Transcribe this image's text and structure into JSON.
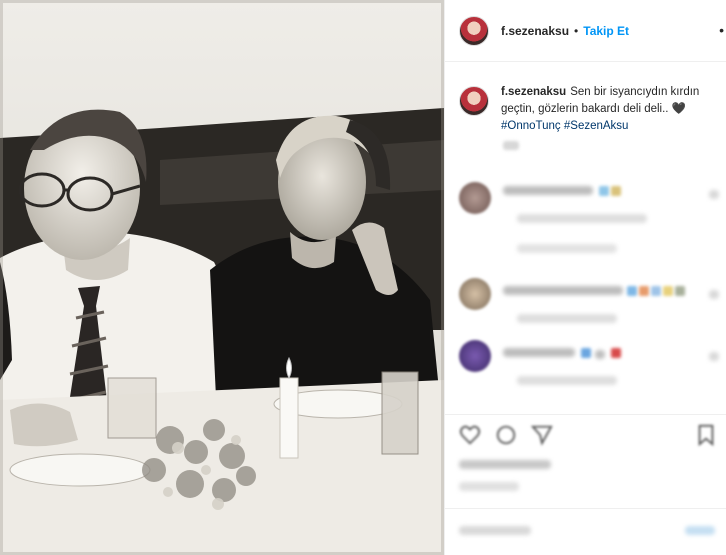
{
  "post": {
    "username": "f.sezenaksu",
    "separator": "•",
    "follow_label": "Takip Et",
    "more_icon": "more-dots-icon",
    "caption": {
      "username": "f.sezenaksu",
      "text": "Sen bir isyancıydın kırdın geçtin, gözlerin bakardı deli deli..",
      "heart": "🖤",
      "hashtags": [
        "#OnnoTunç",
        "#SezenAksu"
      ]
    }
  },
  "colors": {
    "follow_blue": "#0095f6",
    "hashtag_blue": "#00376b",
    "text": "#262626",
    "border": "#efefef"
  },
  "icons": [
    "like-icon",
    "comment-icon",
    "share-icon",
    "bookmark-icon"
  ]
}
